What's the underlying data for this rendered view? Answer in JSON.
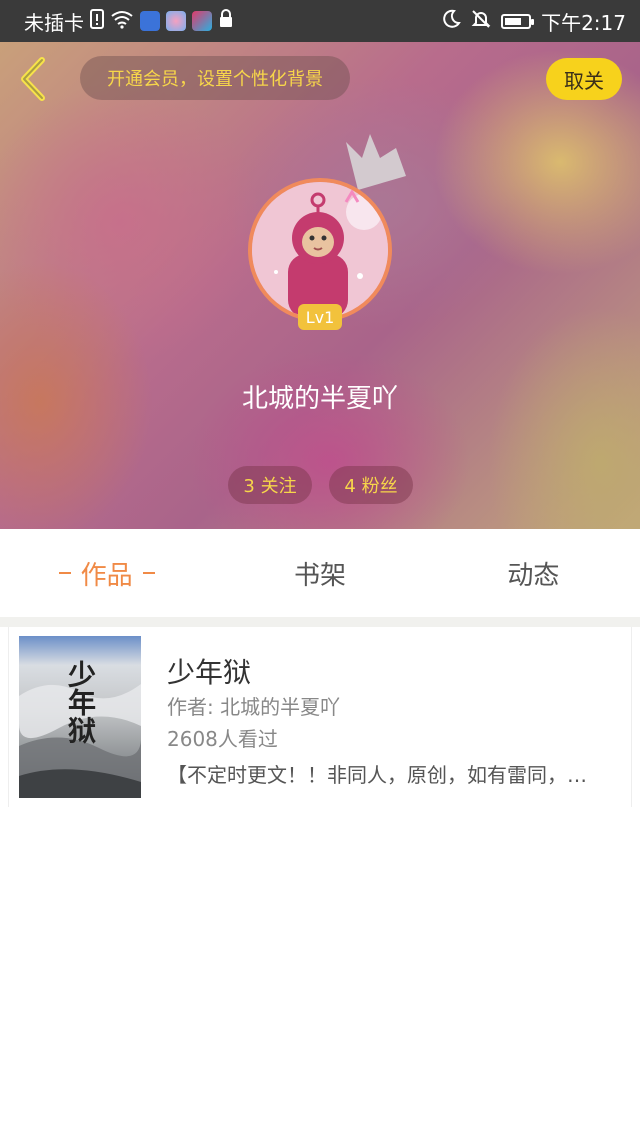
{
  "status_bar": {
    "carrier": "未插卡",
    "time": "下午2:17",
    "icons": [
      "sim-alert-icon",
      "wifi-icon",
      "baidu-icon",
      "app-icon",
      "app-icon-2",
      "lock-icon",
      "moon-icon",
      "mute-bell-icon",
      "battery-icon"
    ]
  },
  "header": {
    "vip_prompt": "开通会员，设置个性化背景",
    "cancel_label": "取关",
    "level": "Lv1",
    "username": "北城的半夏吖",
    "follow_label": "3 关注",
    "fans_label": "4 粉丝"
  },
  "tabs": [
    {
      "label": "作品",
      "active": true
    },
    {
      "label": "书架",
      "active": false
    },
    {
      "label": "动态",
      "active": false
    }
  ],
  "works": [
    {
      "cover_text": "少年狱",
      "title": "少年狱",
      "author": "作者: 北城的半夏吖",
      "views": "2608人看过",
      "description": "【不定时更文！！非同人，原创，如有雷同，…"
    }
  ],
  "colors": {
    "accent": "#f08a46",
    "vip_text": "#f7d64a",
    "cancel_bg": "#f7d21c",
    "level_badge": "#f2c23c"
  }
}
